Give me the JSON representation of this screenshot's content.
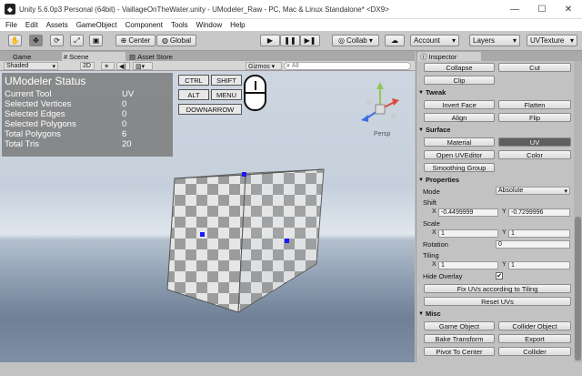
{
  "window": {
    "title": "Unity 5.6.0p3 Personal (64bit) - VaillageOnTheWater.unity - UModeler_Raw - PC, Mac & Linux Standalone* <DX9>",
    "minimize": "—",
    "maximize": "☐",
    "close": "✕"
  },
  "menu": [
    "File",
    "Edit",
    "Assets",
    "GameObject",
    "Component",
    "Tools",
    "Window",
    "Help"
  ],
  "toolbar": {
    "center": "Center",
    "global": "Global",
    "collab": "Collab ▾",
    "account": "Account",
    "layers": "Layers",
    "layout": "UVTexture"
  },
  "tabs": {
    "game": "Game",
    "scene": "Scene",
    "asset_store": "Asset Store",
    "inspector": "Inspector"
  },
  "scenebar": {
    "shading": "Shaded",
    "mode2d": "2D",
    "gizmos": "Gizmos ▾",
    "search": "All"
  },
  "status": {
    "title": "UModeler Status",
    "rows": [
      {
        "k": "Current Tool",
        "v": "UV"
      },
      {
        "k": "Selected Vertices",
        "v": "0"
      },
      {
        "k": "Selected Edges",
        "v": "0"
      },
      {
        "k": "Selected Polygons",
        "v": "0"
      },
      {
        "k": "Total Polygons",
        "v": "6"
      },
      {
        "k": "Total Tris",
        "v": "20"
      }
    ]
  },
  "keys": {
    "ctrl": "CTRL",
    "shift": "SHIFT",
    "alt": "ALT",
    "menu": "MENU",
    "downarrow": "DOWNARROW"
  },
  "persp": "Persp",
  "inspector": {
    "top_buttons": [
      "Collapse",
      "Cut",
      "Clip"
    ],
    "tweak": {
      "title": "Tweak",
      "buttons": [
        "Invert Face",
        "Flatten",
        "Align",
        "Flip"
      ]
    },
    "surface": {
      "title": "Surface",
      "buttons": [
        "Material",
        "UV",
        "Open UVEditor",
        "Color",
        "Smoothing Group"
      ]
    },
    "properties": {
      "title": "Properties",
      "mode_label": "Mode",
      "mode_value": "Absolute",
      "shift_label": "Shift",
      "shift_x": "-0.4499999",
      "shift_y": "-0.7299996",
      "scale_label": "Scale",
      "scale_x": "1",
      "scale_y": "1",
      "rotation_label": "Rotation",
      "rotation_value": "0",
      "tiling_label": "Tiling",
      "tiling_x": "1",
      "tiling_y": "1",
      "hide_overlay_label": "Hide Overlay",
      "hide_overlay_checked": "✔",
      "fix_uvs": "Fix UVs according to Tiling",
      "reset_uvs": "Reset UVs"
    },
    "misc": {
      "title": "Misc",
      "buttons": [
        "Game Object",
        "Collider Object",
        "Bake Transform",
        "Export",
        "Pivot To Center",
        "Collider"
      ]
    }
  },
  "colors": {
    "selected_button": "#5e5e5e",
    "vertex": "#1a1aff"
  }
}
